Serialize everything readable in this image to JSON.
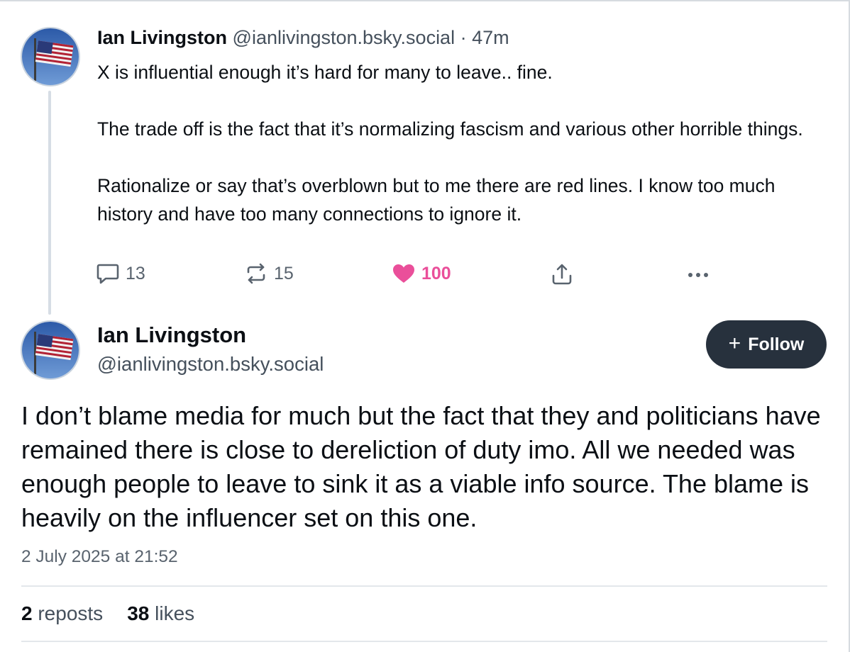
{
  "parent_post": {
    "author_name": "Ian Livingston",
    "author_handle": "@ianlivingston.bsky.social",
    "separator": "·",
    "time_ago": "47m",
    "paragraphs": [
      "X is influential enough it’s hard for many to leave.. fine.",
      "The trade off is the fact that it’s normalizing fascism and various other horrible things.",
      "Rationalize or say that’s overblown but to me there are red lines. I know too much history and have too many connections to ignore it."
    ],
    "reply_count": "13",
    "repost_count": "15",
    "like_count": "100"
  },
  "main_post": {
    "author_name": "Ian Livingston",
    "author_handle": "@ianlivingston.bsky.social",
    "follow_label": "Follow",
    "text": "I don’t blame media for much but the fact that they and politicians have remained there is close to dereliction of duty imo. All we needed was enough people to leave to sink it as a viable info source. The blame is heavily on the influencer set on this one.",
    "timestamp": "2 July 2025 at 21:52",
    "reposts_count": "2",
    "reposts_label": "reposts",
    "likes_count": "38",
    "likes_label": "likes"
  },
  "icons": {
    "avatar": "us-flag-avatar",
    "reply": "reply-icon",
    "repost": "repost-icon",
    "like": "heart-icon",
    "share": "share-icon",
    "more": "more-icon",
    "follow": "plus-icon"
  },
  "colors": {
    "like_pink": "#ea4f9a",
    "follow_bg": "#27313d",
    "muted_text": "#59636e",
    "thread_line": "#d6dde5"
  }
}
